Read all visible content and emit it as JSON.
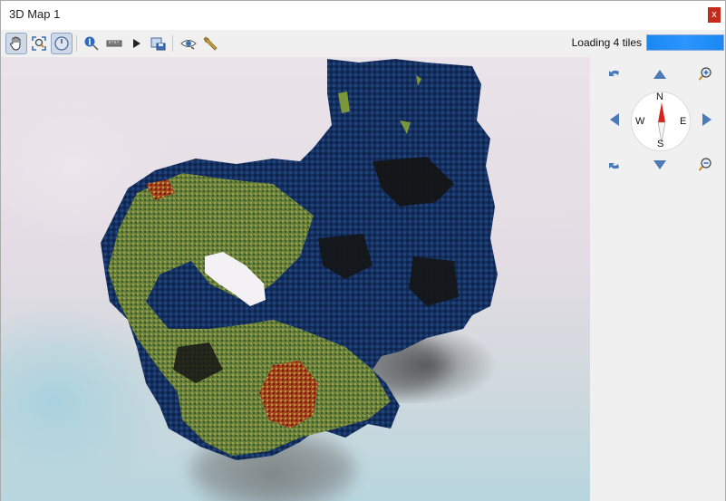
{
  "window": {
    "title": "3D Map 1",
    "close_label": "x"
  },
  "toolbar": {
    "tools": [
      {
        "name": "pan-camera",
        "icon": "hand-icon",
        "active": true
      },
      {
        "name": "zoom-full",
        "icon": "zoom-full-icon",
        "active": false
      },
      {
        "name": "toggle-on-screen-navigation",
        "icon": "navigation-compass-icon",
        "active": true
      },
      {
        "name": "identify",
        "icon": "identify-icon",
        "active": false
      },
      {
        "name": "measure-line",
        "icon": "measure-ruler-icon",
        "active": false
      },
      {
        "name": "animations",
        "icon": "play-icon",
        "active": false
      },
      {
        "name": "save-as-image",
        "icon": "save-image-icon",
        "active": false
      },
      {
        "name": "camera-view",
        "icon": "eye-icon",
        "active": false
      },
      {
        "name": "configure",
        "icon": "wrench-icon",
        "active": false
      }
    ],
    "loading_text": "Loading 4 tiles",
    "loading_progress": 1.0
  },
  "navigation": {
    "compass": {
      "north": "N",
      "south": "S",
      "east": "E",
      "west": "W"
    },
    "accent": "#4a7ab8"
  },
  "terrain": {
    "colors": [
      "#0f2a55",
      "#1b3f78",
      "#6f8a3a",
      "#b0a94a",
      "#a8431c",
      "#7a160e",
      "#1a1a1a"
    ]
  }
}
